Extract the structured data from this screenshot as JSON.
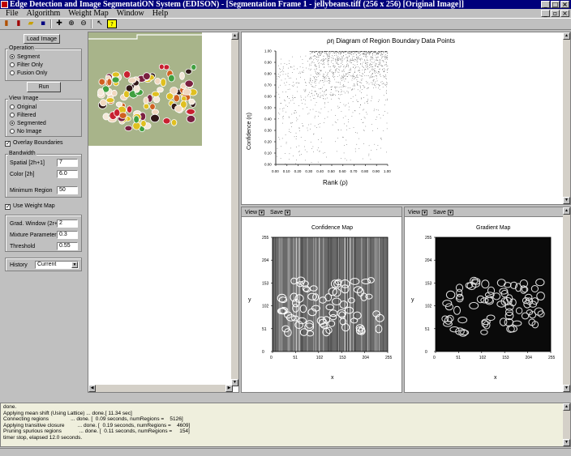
{
  "window": {
    "title": "Edge Detection and Image SegmentatiON System (EDISON) - [Segmentation Frame 1 - jellybeans.tiff (256 x 256) [Original Image]]"
  },
  "menu": [
    "File",
    "Algorithm",
    "Weight Map",
    "Window",
    "Help"
  ],
  "toolbar": [
    "new-icon",
    "open-icon",
    "folder-icon",
    "save-icon",
    "crosshair-icon",
    "zoom-in-icon",
    "zoom-out-icon",
    "pointer-icon",
    "help-icon"
  ],
  "left": {
    "load_image": "Load Image",
    "operation": {
      "title": "Operation",
      "options": [
        "Segment",
        "Filter Only",
        "Fusion Only"
      ],
      "selected": "Segment"
    },
    "run": "Run",
    "view_image": {
      "title": "View Image",
      "options": [
        "Original",
        "Filtered",
        "Segmented",
        "No Image"
      ],
      "selected": "Segmented"
    },
    "overlay_boundaries": {
      "label": "Overlay Boundaries",
      "checked": true
    },
    "bandwidth": {
      "title": "Bandwidth",
      "spatial_label": "Spatial [2h+1]",
      "spatial_value": "7",
      "color_label": "Color [2h]",
      "color_value": "6.0",
      "min_region_label": "Minimum Region",
      "min_region_value": "50"
    },
    "use_weight_map": {
      "label": "Use Weight Map",
      "checked": true
    },
    "weight": {
      "grad_label": "Grad. Window (2r+1)",
      "grad_value": "2",
      "mixture_label": "Mixture Parameter",
      "mixture_value": "0.3",
      "threshold_label": "Threshold",
      "threshold_value": "0.55"
    },
    "history": {
      "label": "History",
      "value": "Current"
    }
  },
  "panels": {
    "view_label": "View",
    "save_label": "Save"
  },
  "chart_data": [
    {
      "type": "scatter",
      "title": "ρη  Diagram of Region Boundary Data Points",
      "xlabel": "Rank (ρ)",
      "ylabel": "Confidence (η)",
      "xlim": [
        0,
        1
      ],
      "ylim": [
        0,
        1
      ],
      "xticks": [
        "0.00",
        "0.10",
        "0.20",
        "0.30",
        "0.40",
        "0.50",
        "0.60",
        "0.70",
        "0.80",
        "0.90",
        "1.00"
      ],
      "yticks": [
        "0.00",
        "0.10",
        "0.20",
        "0.30",
        "0.40",
        "0.50",
        "0.60",
        "0.70",
        "0.80",
        "0.90",
        "1.00"
      ],
      "pattern": "dense upper-right; points concentrated at rank 0.3-1.0, confidence 0.8-1.0, sparse elsewhere"
    },
    {
      "type": "heatmap",
      "title": "Confidence Map",
      "xlabel": "x",
      "ylabel": "y",
      "xlim": [
        0,
        255
      ],
      "ylim": [
        0,
        255
      ],
      "xticks": [
        "0",
        "51",
        "102",
        "153",
        "204",
        "255"
      ],
      "yticks": [
        "0",
        "51",
        "102",
        "153",
        "204",
        "255"
      ]
    },
    {
      "type": "heatmap",
      "title": "Gradient Map",
      "xlabel": "x",
      "ylabel": "y",
      "xlim": [
        0,
        255
      ],
      "ylim": [
        0,
        255
      ],
      "xticks": [
        "0",
        "51",
        "102",
        "153",
        "204",
        "255"
      ],
      "yticks": [
        "0",
        "51",
        "102",
        "153",
        "204",
        "255"
      ]
    }
  ],
  "console": {
    "lines": [
      "done.",
      "Applying mean shift (Using Lattice) ... done.[ 11.34 sec]",
      "Connecting regions               ... done. [  0.09 seconds, numRegions =    5126]",
      "Applying transitive closure         ... done. [  0.19 seconds, numRegions =    4609]",
      "Pruning spurious regions            ... done. [  0.11 seconds, numRegions =     154]",
      "timer stop, elapsed 12.0 seconds."
    ]
  }
}
